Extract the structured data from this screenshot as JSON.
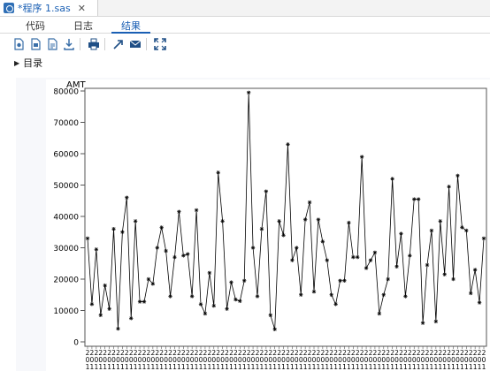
{
  "window": {
    "doc_tab_title": "*程序 1.sas",
    "close_glyph": "✕"
  },
  "subtabs": [
    {
      "label": "代码"
    },
    {
      "label": "日志"
    },
    {
      "label": "结果",
      "active": true
    }
  ],
  "toolbar": {
    "icons": [
      "new-document-icon",
      "export-pdf-icon",
      "export-rtf-icon",
      "download-icon",
      "print-icon",
      "open-new-window-icon",
      "email-icon",
      "expand-icon"
    ]
  },
  "outline": {
    "label": "目录"
  },
  "colors": {
    "accent": "#1a5fb4",
    "plot_line": "#000000",
    "panel_bg": "#f7f8fb"
  },
  "chart_data": {
    "type": "line",
    "ylabel": "AMT",
    "ylim": [
      0,
      80000
    ],
    "y_ticks": [
      0,
      10000,
      20000,
      30000,
      40000,
      50000,
      60000,
      70000,
      80000
    ],
    "y_tick_labels": [
      "0",
      "10000",
      "20000",
      "30000",
      "40000",
      "50000",
      "60000",
      "70000",
      "80000"
    ],
    "marker": "asterisk",
    "series": [
      {
        "values": [
          33000,
          12000,
          29500,
          8500,
          18000,
          10500,
          36000,
          4200,
          35000,
          46000,
          7500,
          38500,
          12800,
          12800,
          20000,
          18500,
          30000,
          36500,
          29000,
          14500,
          27000,
          41500,
          27500,
          28000,
          14500,
          42000,
          12000,
          9000,
          22000,
          11500,
          54000,
          38500,
          10500,
          19000,
          13500,
          13000,
          19500,
          79500,
          30000,
          14500,
          36000,
          48000,
          8500,
          4000,
          38500,
          34000,
          63000,
          26000,
          30000,
          15000,
          39000,
          44500,
          16000,
          39000,
          32000,
          26000,
          15000,
          12000,
          19500,
          19500,
          38000,
          27000,
          27000,
          59000,
          23500,
          26000,
          28500,
          9000,
          15000,
          20000,
          52000,
          24000,
          34500,
          14500,
          27500,
          45500,
          45500,
          6000,
          24500,
          35500,
          6500,
          38500,
          21500,
          49500,
          20000,
          53000,
          36500,
          35500,
          15500,
          23000,
          12500,
          33000
        ]
      }
    ],
    "x_tick_char_rows": [
      "2",
      "0",
      "1"
    ],
    "x_tick_count": 92
  }
}
